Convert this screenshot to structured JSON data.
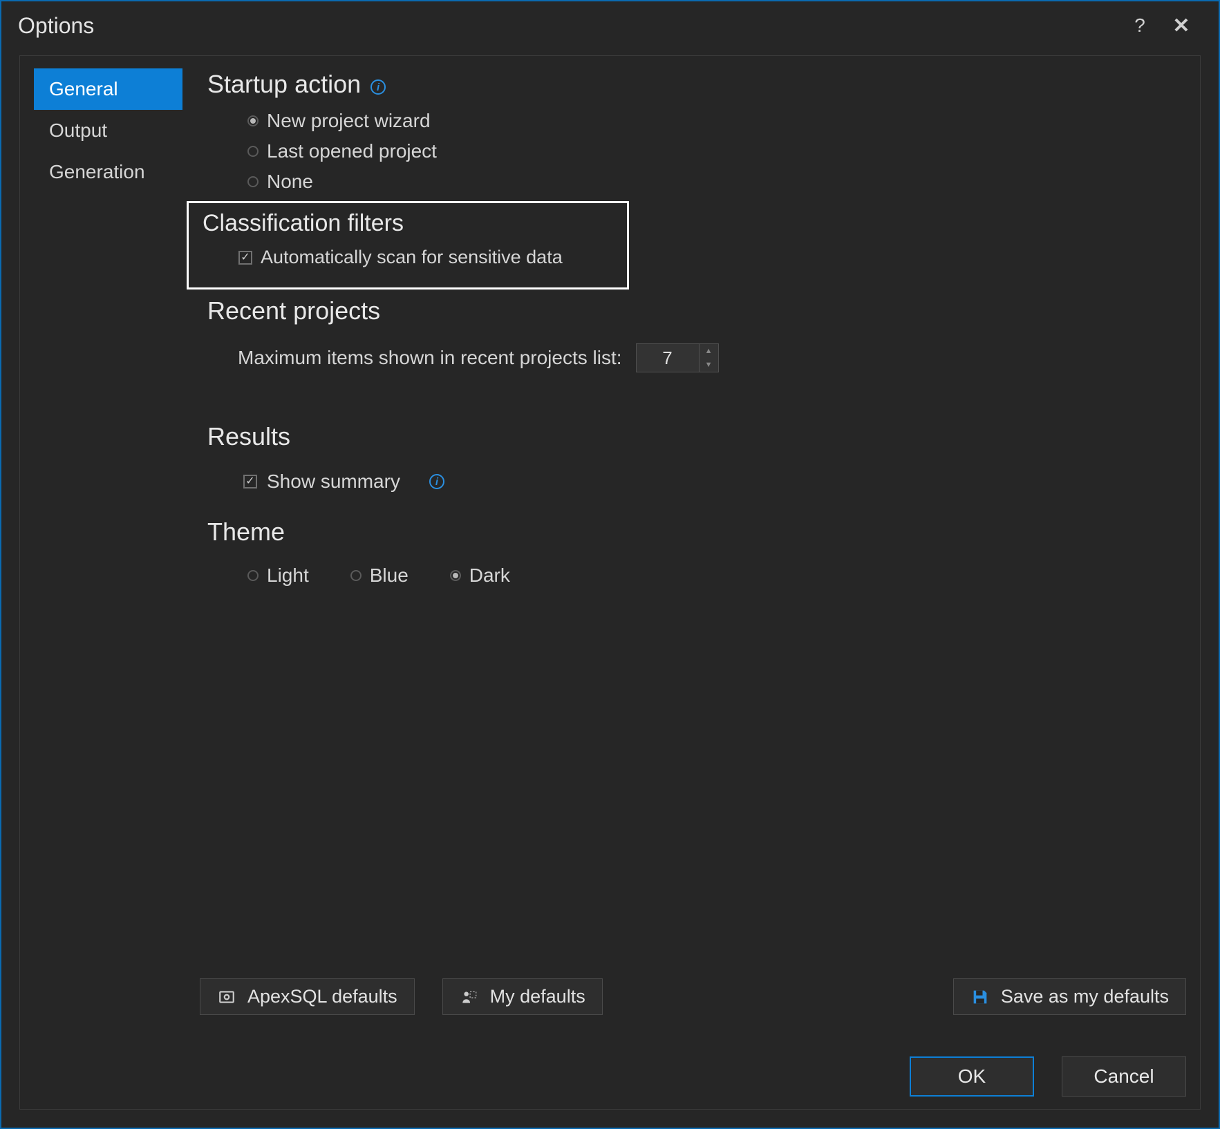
{
  "window": {
    "title": "Options"
  },
  "sidebar": {
    "tabs": [
      {
        "label": "General",
        "active": true
      },
      {
        "label": "Output",
        "active": false
      },
      {
        "label": "Generation",
        "active": false
      }
    ]
  },
  "sections": {
    "startup": {
      "title": "Startup action",
      "options": [
        {
          "label": "New project wizard",
          "selected": true
        },
        {
          "label": "Last opened project",
          "selected": false
        },
        {
          "label": "None",
          "selected": false
        }
      ]
    },
    "classification": {
      "title": "Classification filters",
      "auto_scan": {
        "label": "Automatically scan for sensitive data",
        "checked": true
      }
    },
    "recent": {
      "title": "Recent projects",
      "max_label": "Maximum items shown in recent projects list:",
      "max_value": "7"
    },
    "results": {
      "title": "Results",
      "show_summary": {
        "label": "Show summary",
        "checked": true
      }
    },
    "theme": {
      "title": "Theme",
      "options": [
        {
          "label": "Light",
          "selected": false
        },
        {
          "label": "Blue",
          "selected": false
        },
        {
          "label": "Dark",
          "selected": true
        }
      ]
    }
  },
  "footer": {
    "apex_defaults": "ApexSQL defaults",
    "my_defaults": "My defaults",
    "save_defaults": "Save as my defaults",
    "ok": "OK",
    "cancel": "Cancel"
  }
}
